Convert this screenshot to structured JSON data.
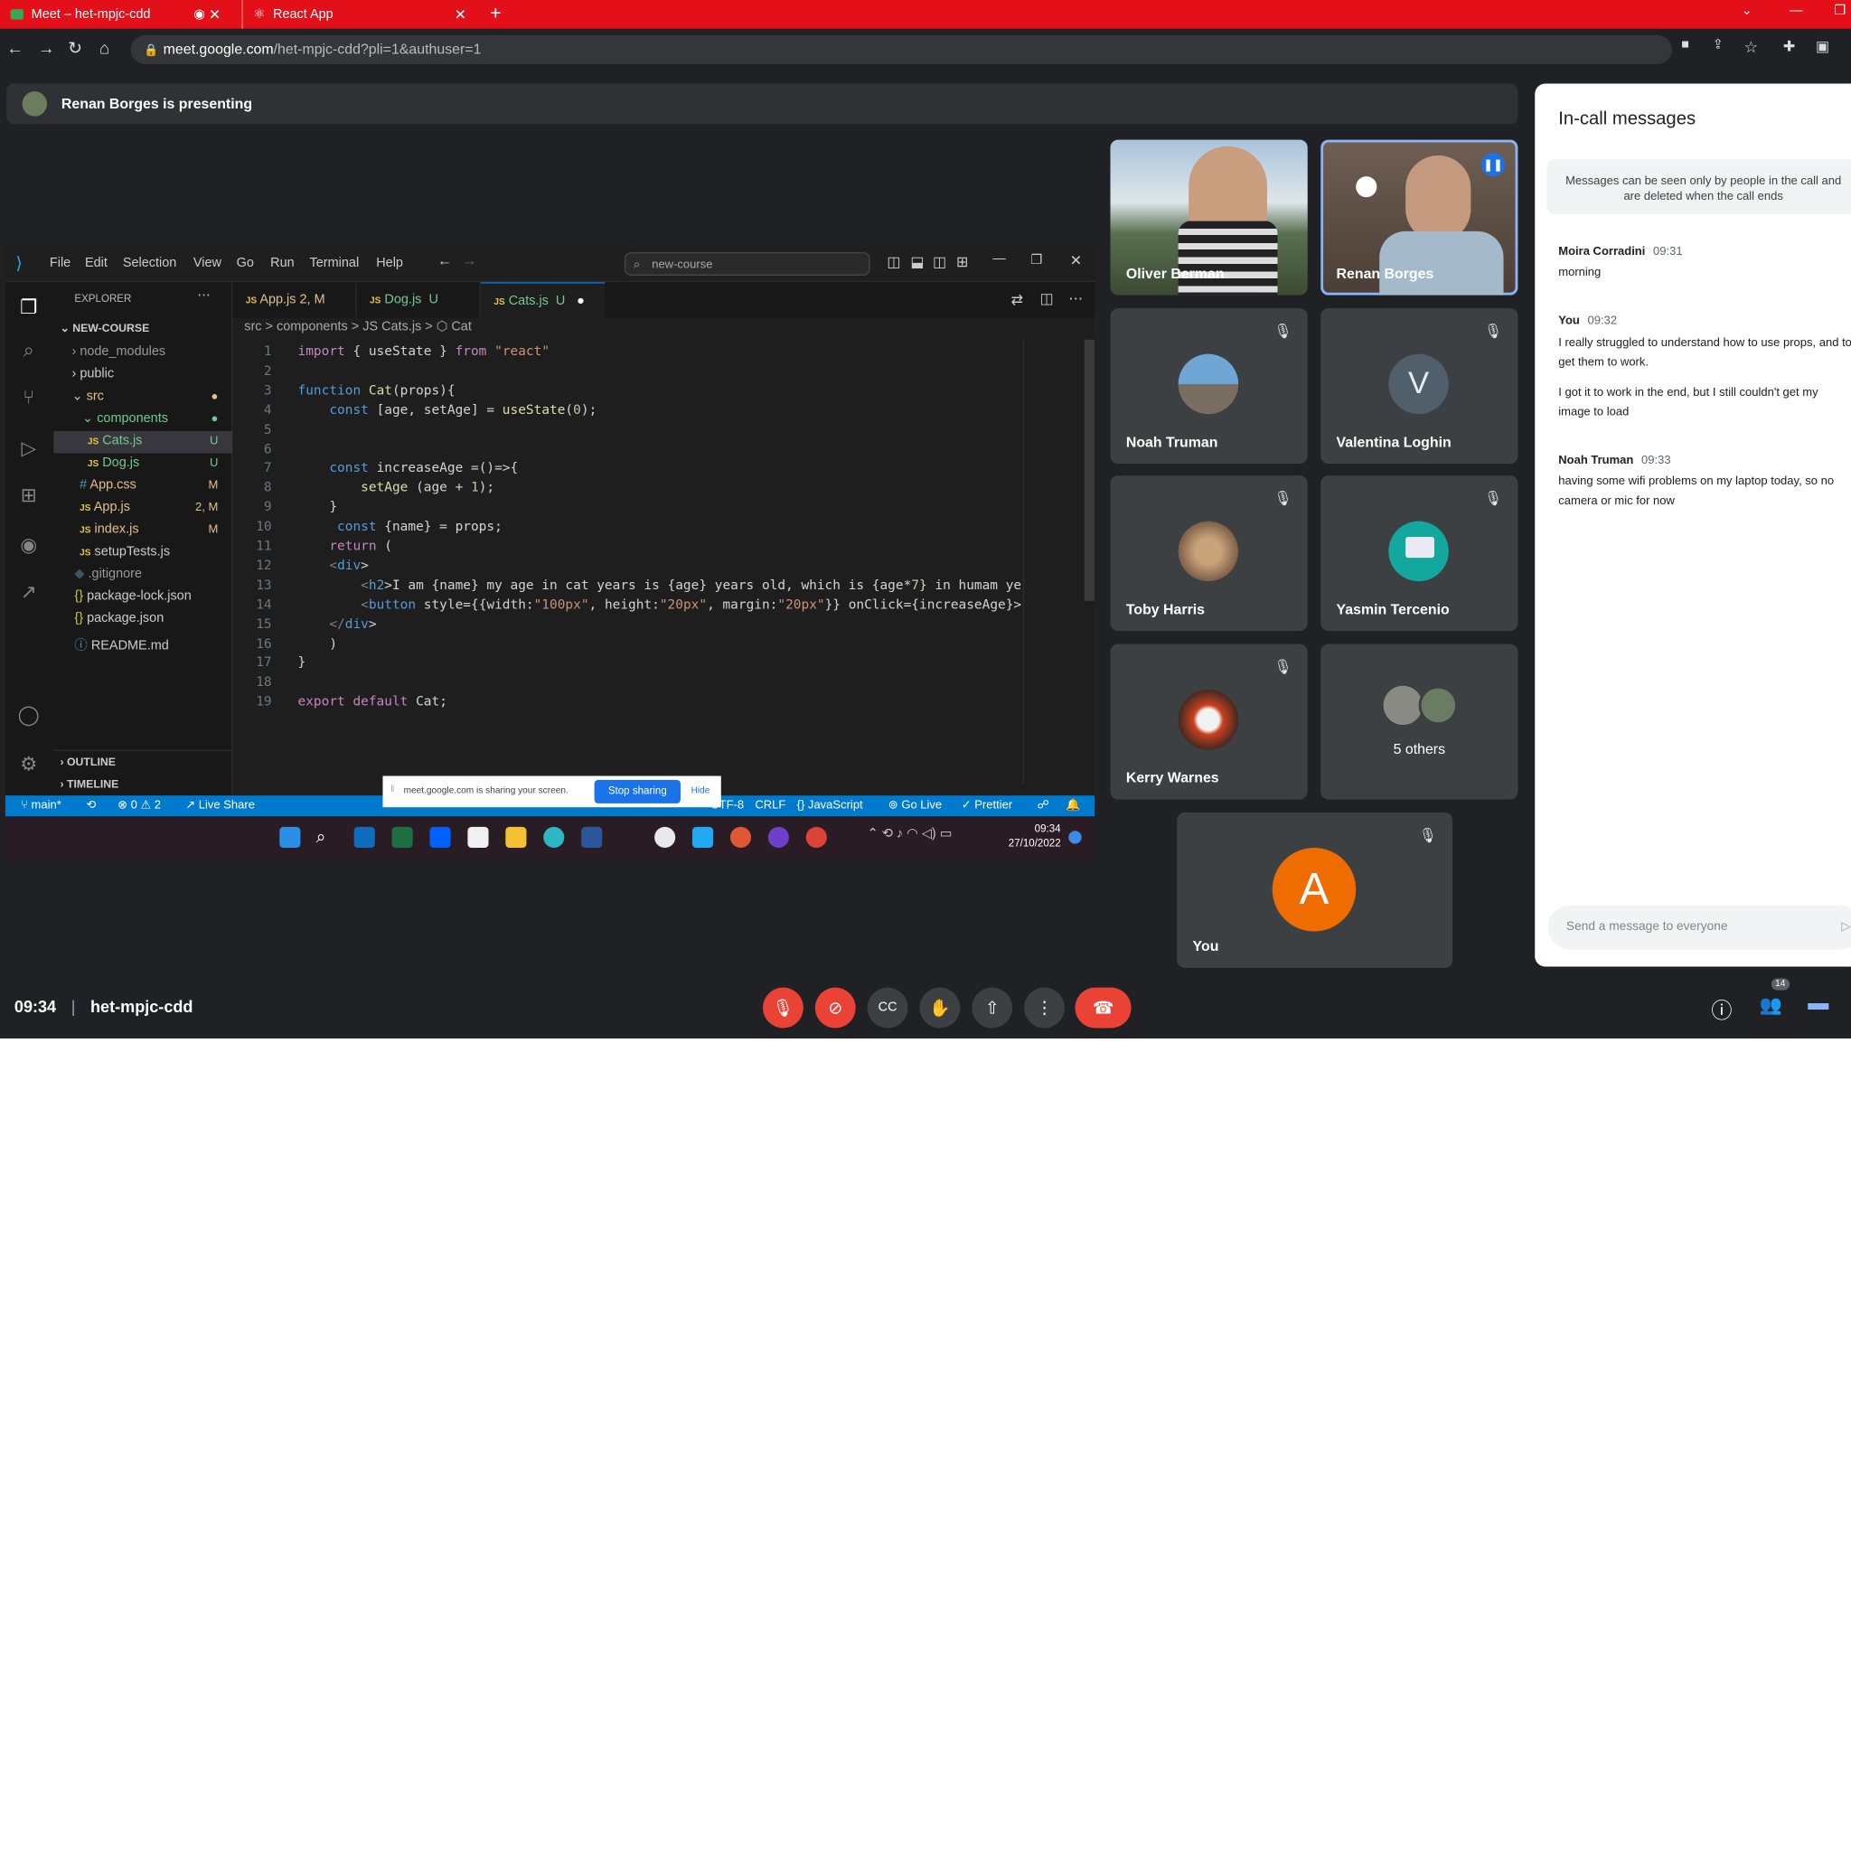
{
  "browser": {
    "tab1": "Meet – het-mpjc-cdd",
    "tab2": "React App",
    "url_host": "meet.google.com",
    "url_path": "/het-mpjc-cdd?pli=1&authuser=1"
  },
  "presenting": "Renan Borges is presenting",
  "vscode": {
    "menu": [
      "File",
      "Edit",
      "Selection",
      "View",
      "Go",
      "Run",
      "Terminal",
      "Help"
    ],
    "search": "new-course",
    "explorer": "EXPLORER",
    "project": "NEW-COURSE",
    "tree": [
      {
        "label": "node_modules",
        "status": ""
      },
      {
        "label": "public",
        "status": ""
      },
      {
        "label": "src",
        "status": "●"
      },
      {
        "label": "components",
        "status": "●"
      },
      {
        "label": "Cats.js",
        "status": "U"
      },
      {
        "label": "Dog.js",
        "status": "U"
      },
      {
        "label": "App.css",
        "status": "M"
      },
      {
        "label": "App.js",
        "status": "2, M"
      },
      {
        "label": "index.js",
        "status": "M"
      },
      {
        "label": "setupTests.js",
        "status": ""
      },
      {
        "label": ".gitignore",
        "status": ""
      },
      {
        "label": "package-lock.json",
        "status": ""
      },
      {
        "label": "package.json",
        "status": ""
      },
      {
        "label": "README.md",
        "status": ""
      }
    ],
    "outline": "OUTLINE",
    "timeline": "TIMELINE",
    "tabs": [
      {
        "name": "App.js",
        "status": "2, M"
      },
      {
        "name": "Dog.js",
        "status": "U"
      },
      {
        "name": "Cats.js",
        "status": "U"
      }
    ],
    "breadcrumb": "src > components > JS Cats.js > ⬡ Cat",
    "code": [
      "import { useState } from \"react\"",
      "",
      "function Cat(props){",
      "    const [age, setAge] = useState(0);",
      "",
      "",
      "    const increaseAge =()=>{",
      "        setAge (age + 1);",
      "    }",
      "     const {name} = props;",
      "    return (",
      "    <div>",
      "        <h2>I am {name} my age in cat years is {age} years old, which is {age*7} in humam ye",
      "        <button style={{width:\"100px\", height:\"20px\", margin:\"20px\"}} onClick={increaseAge}>",
      "    </div>",
      "    )",
      "}",
      "",
      "export default Cat;"
    ],
    "status": {
      "branch": "main*",
      "errors": "⊗ 0 ⚠ 2",
      "liveshare": "Live Share",
      "encoding": "UTF-8",
      "eol": "CRLF",
      "lang": "{} JavaScript",
      "golive": "Go Live",
      "prettier": "✓ Prettier"
    },
    "share": {
      "text": "meet.google.com is sharing your screen.",
      "stop": "Stop sharing",
      "hide": "Hide"
    },
    "clock": {
      "time": "09:34",
      "date": "27/10/2022"
    }
  },
  "participants": [
    {
      "name": "Oliver Berman"
    },
    {
      "name": "Renan Borges"
    },
    {
      "name": "Noah Truman"
    },
    {
      "name": "Valentina Loghin",
      "initial": "V"
    },
    {
      "name": "Toby Harris"
    },
    {
      "name": "Yasmin Tercenio"
    },
    {
      "name": "Kerry Warnes"
    },
    {
      "name": "5 others"
    },
    {
      "name": "You",
      "initial": "A"
    }
  ],
  "chat": {
    "title": "In-call messages",
    "notice": "Messages can be seen only by people in the call and are deleted when the call ends",
    "messages": [
      {
        "sender": "Moira Corradini",
        "time": "09:31",
        "text": [
          "morning"
        ]
      },
      {
        "sender": "You",
        "time": "09:32",
        "text": [
          "I really struggled to understand how to use props, and to get them to work.",
          "I got it to work in the end, but I still couldn't get my image to load"
        ]
      },
      {
        "sender": "Noah Truman",
        "time": "09:33",
        "text": [
          "having some wifi problems on my laptop today, so no camera or mic for now"
        ]
      }
    ],
    "placeholder": "Send a message to everyone"
  },
  "bottom": {
    "time": "09:34",
    "code": "het-mpjc-cdd",
    "people_count": "14"
  }
}
